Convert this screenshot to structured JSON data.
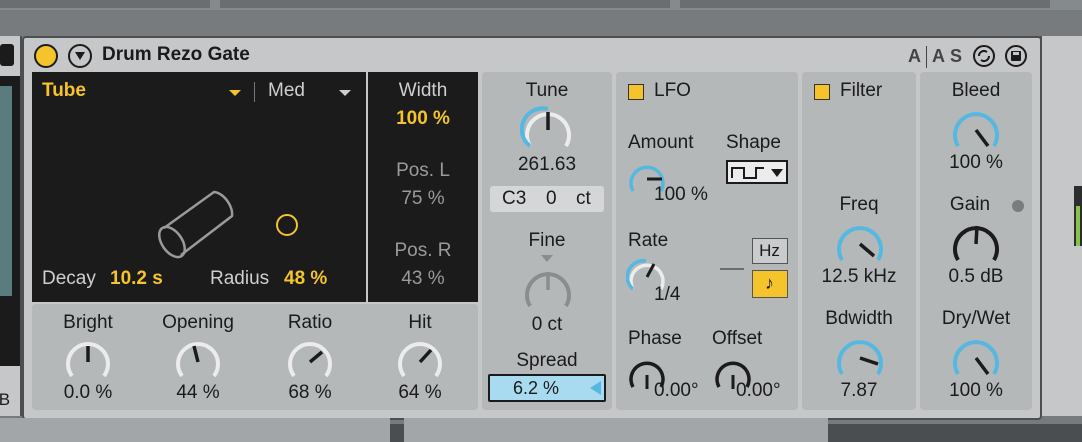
{
  "device": {
    "title": "Drum Rezo Gate",
    "header_buttons": [
      "A",
      "A",
      "S"
    ],
    "left_partial_label": "IB"
  },
  "resonator": {
    "type": "Tube",
    "quality": "Med",
    "decay_label": "Decay",
    "decay_value": "10.2 s",
    "radius_label": "Radius",
    "radius_value": "48 %",
    "width_label": "Width",
    "width_value": "100 %",
    "posl_label": "Pos. L",
    "posl_value": "75 %",
    "posr_label": "Pos. R",
    "posr_value": "43 %"
  },
  "knobs_bottom": [
    {
      "label": "Bright",
      "value": "0.0 %",
      "level": 0.5
    },
    {
      "label": "Opening",
      "value": "44 %",
      "level": 0.44
    },
    {
      "label": "Ratio",
      "value": "68 %",
      "level": 0.68
    },
    {
      "label": "Hit",
      "value": "64 %",
      "level": 0.64
    }
  ],
  "tune": {
    "label": "Tune",
    "value": "261.63",
    "note": "C3",
    "cents": "0",
    "cents_unit": "ct",
    "fine_label": "Fine",
    "fine_value": "0 ct",
    "spread_label": "Spread",
    "spread_value": "6.2 %"
  },
  "lfo": {
    "label": "LFO",
    "amount_label": "Amount",
    "amount_value": "100 %",
    "shape_label": "Shape",
    "rate_label": "Rate",
    "rate_value": "1/4",
    "hz_label": "Hz",
    "sync_glyph": "♪",
    "phase_label": "Phase",
    "phase_value": "0.00°",
    "offset_label": "Offset",
    "offset_value": "0.00°"
  },
  "filter": {
    "label": "Filter",
    "freq_label": "Freq",
    "freq_value": "12.5 kHz",
    "bw_label": "Bdwidth",
    "bw_value": "7.87"
  },
  "output": {
    "bleed_label": "Bleed",
    "bleed_value": "100 %",
    "gain_label": "Gain",
    "gain_value": "0.5 dB",
    "drywet_label": "Dry/Wet",
    "drywet_value": "100 %"
  },
  "colors": {
    "accent": "#f5c32c",
    "knob_arc": "#55b8e0",
    "panel": "#b5b8b9",
    "dark_display": "#1b1b1b"
  }
}
